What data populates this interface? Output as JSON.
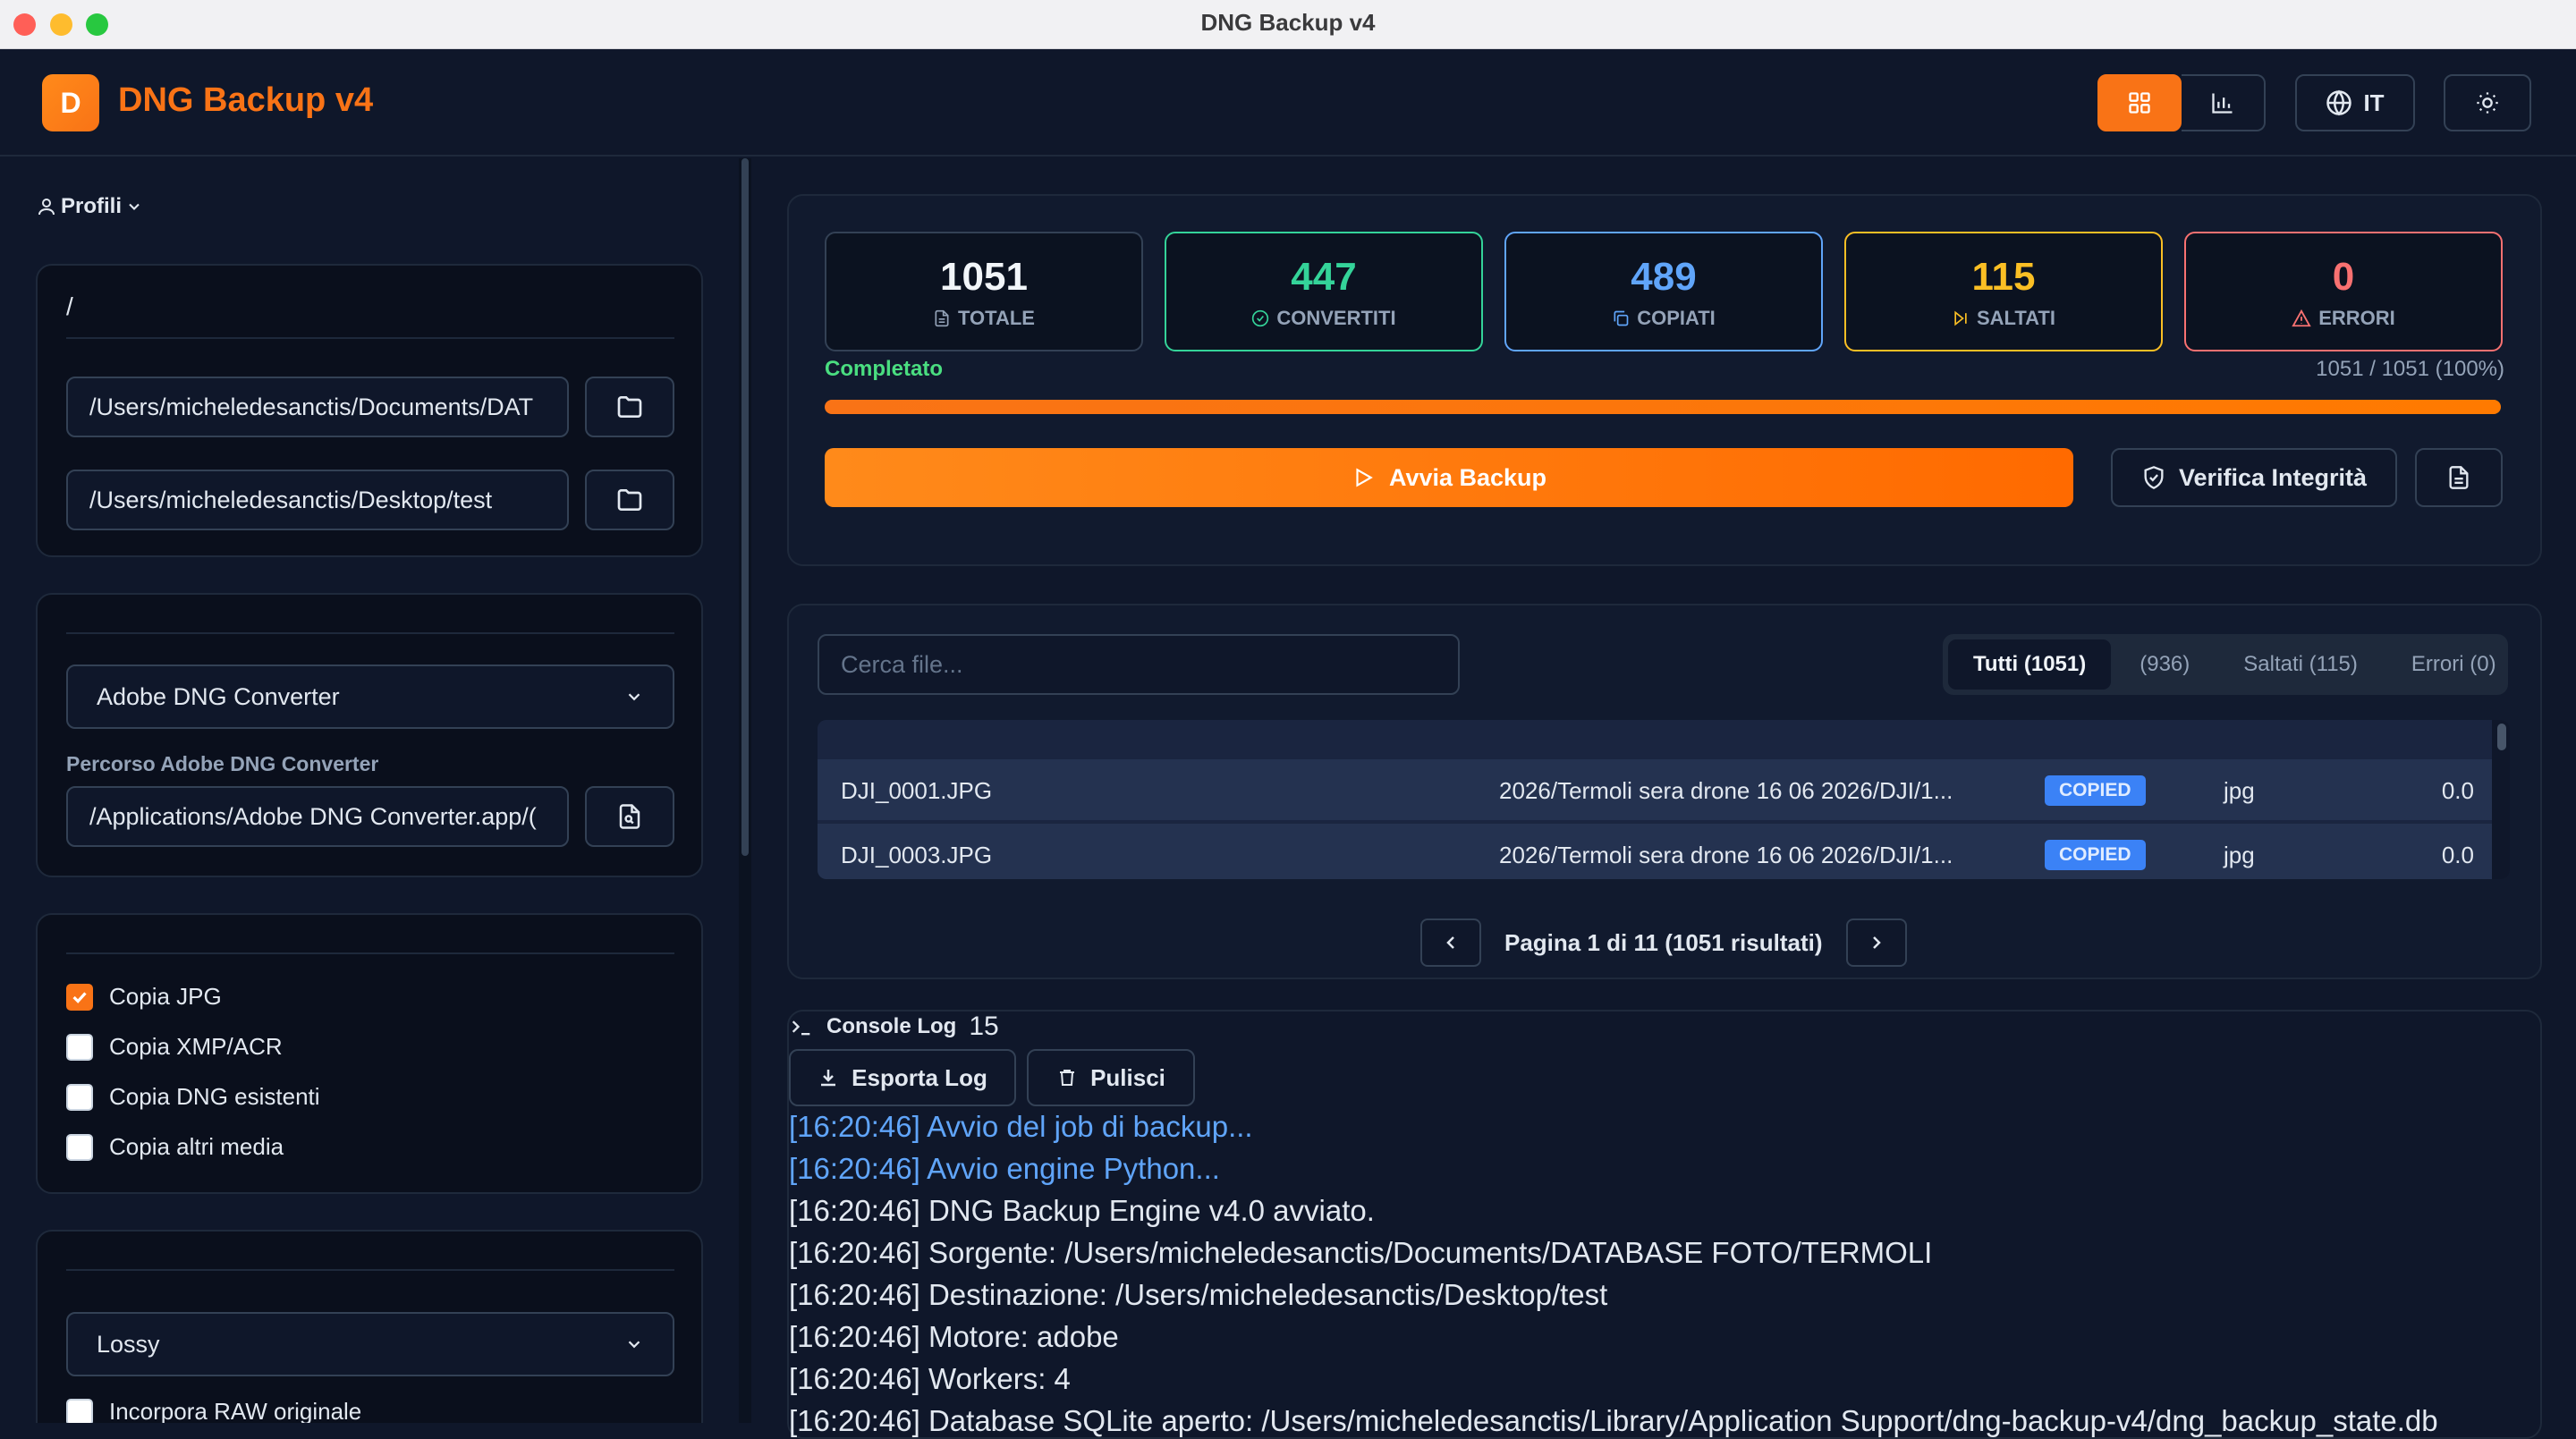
{
  "window": {
    "title": "DNG Backup v4"
  },
  "header": {
    "logo_letter": "D",
    "app_name": "DNG Backup v4",
    "lang": "IT",
    "icons": [
      "grid-icon",
      "chart-icon",
      "globe-icon",
      "sun-icon"
    ],
    "accent": "#f97316"
  },
  "sidebar": {
    "profiles_label": "Profili",
    "paths_card": {
      "title": "/",
      "source": "/Users/micheledesanctis/Documents/DAT",
      "destination": "/Users/micheledesanctis/Desktop/test"
    },
    "converter_card": {
      "selected": "Adobe DNG Converter",
      "path_label": "Percorso Adobe DNG Converter",
      "path_value": "/Applications/Adobe DNG Converter.app/("
    },
    "copy_card": {
      "options": [
        {
          "label": "Copia JPG",
          "checked": true
        },
        {
          "label": "Copia XMP/ACR",
          "checked": false
        },
        {
          "label": "Copia DNG esistenti",
          "checked": false
        },
        {
          "label": "Copia altri media",
          "checked": false
        }
      ]
    },
    "compression_card": {
      "selected": "Lossy",
      "embed_label": "Incorpora RAW originale"
    }
  },
  "stats": [
    {
      "value": "1051",
      "label": "TOTALE",
      "color": "#f1f5f9",
      "border": "#334155"
    },
    {
      "value": "447",
      "label": "CONVERTITI",
      "color": "#34d399",
      "border": "#34d399"
    },
    {
      "value": "489",
      "label": "COPIATI",
      "color": "#60a5fa",
      "border": "#60a5fa"
    },
    {
      "value": "115",
      "label": "SALTATI",
      "color": "#fbbf24",
      "border": "#fbbf24"
    },
    {
      "value": "0",
      "label": "ERRORI",
      "color": "#f87171",
      "border": "#f87171"
    }
  ],
  "progress": {
    "status": "Completato",
    "count": "1051 / 1051 (100%)",
    "fraction": 1.0
  },
  "actions": {
    "start": "Avvia Backup",
    "verify": "Verifica Integrità"
  },
  "files": {
    "search_placeholder": "Cerca file...",
    "tabs": [
      "Tutti (1051)",
      "(936)",
      "Saltati (115)",
      "Errori (0)"
    ],
    "rows": [
      {
        "name": "DJI_0001.JPG",
        "path": "2026/Termoli sera drone 16 06 2026/DJI/1...",
        "status": "COPIED",
        "ext": "jpg",
        "size": "0.0"
      },
      {
        "name": "DJI_0003.JPG",
        "path": "2026/Termoli sera drone 16 06 2026/DJI/1...",
        "status": "COPIED",
        "ext": "jpg",
        "size": "0.0"
      }
    ],
    "pagination": "Pagina 1 di 11 (1051 risultati)"
  },
  "console": {
    "title": "Console Log",
    "count": "15",
    "export": "Esporta Log",
    "clear": "Pulisci",
    "lines": [
      {
        "text": "[16:20:46] Avvio del job di backup...",
        "color": "#60a5fa"
      },
      {
        "text": "[16:20:46] Avvio engine Python...",
        "color": "#60a5fa"
      },
      {
        "text": "[16:20:46] DNG Backup Engine v4.0 avviato.",
        "color": "#e2e8f0"
      },
      {
        "text": "[16:20:46] Sorgente: /Users/micheledesanctis/Documents/DATABASE FOTO/TERMOLI",
        "color": "#e2e8f0"
      },
      {
        "text": "[16:20:46] Destinazione: /Users/micheledesanctis/Desktop/test",
        "color": "#e2e8f0"
      },
      {
        "text": "[16:20:46] Motore: adobe",
        "color": "#e2e8f0"
      },
      {
        "text": "[16:20:46] Workers: 4",
        "color": "#e2e8f0"
      },
      {
        "text": "[16:20:46] Database SQLite aperto: /Users/micheledesanctis/Library/Application Support/dng-backup-v4/dng_backup_state.db",
        "color": "#e2e8f0"
      }
    ]
  }
}
